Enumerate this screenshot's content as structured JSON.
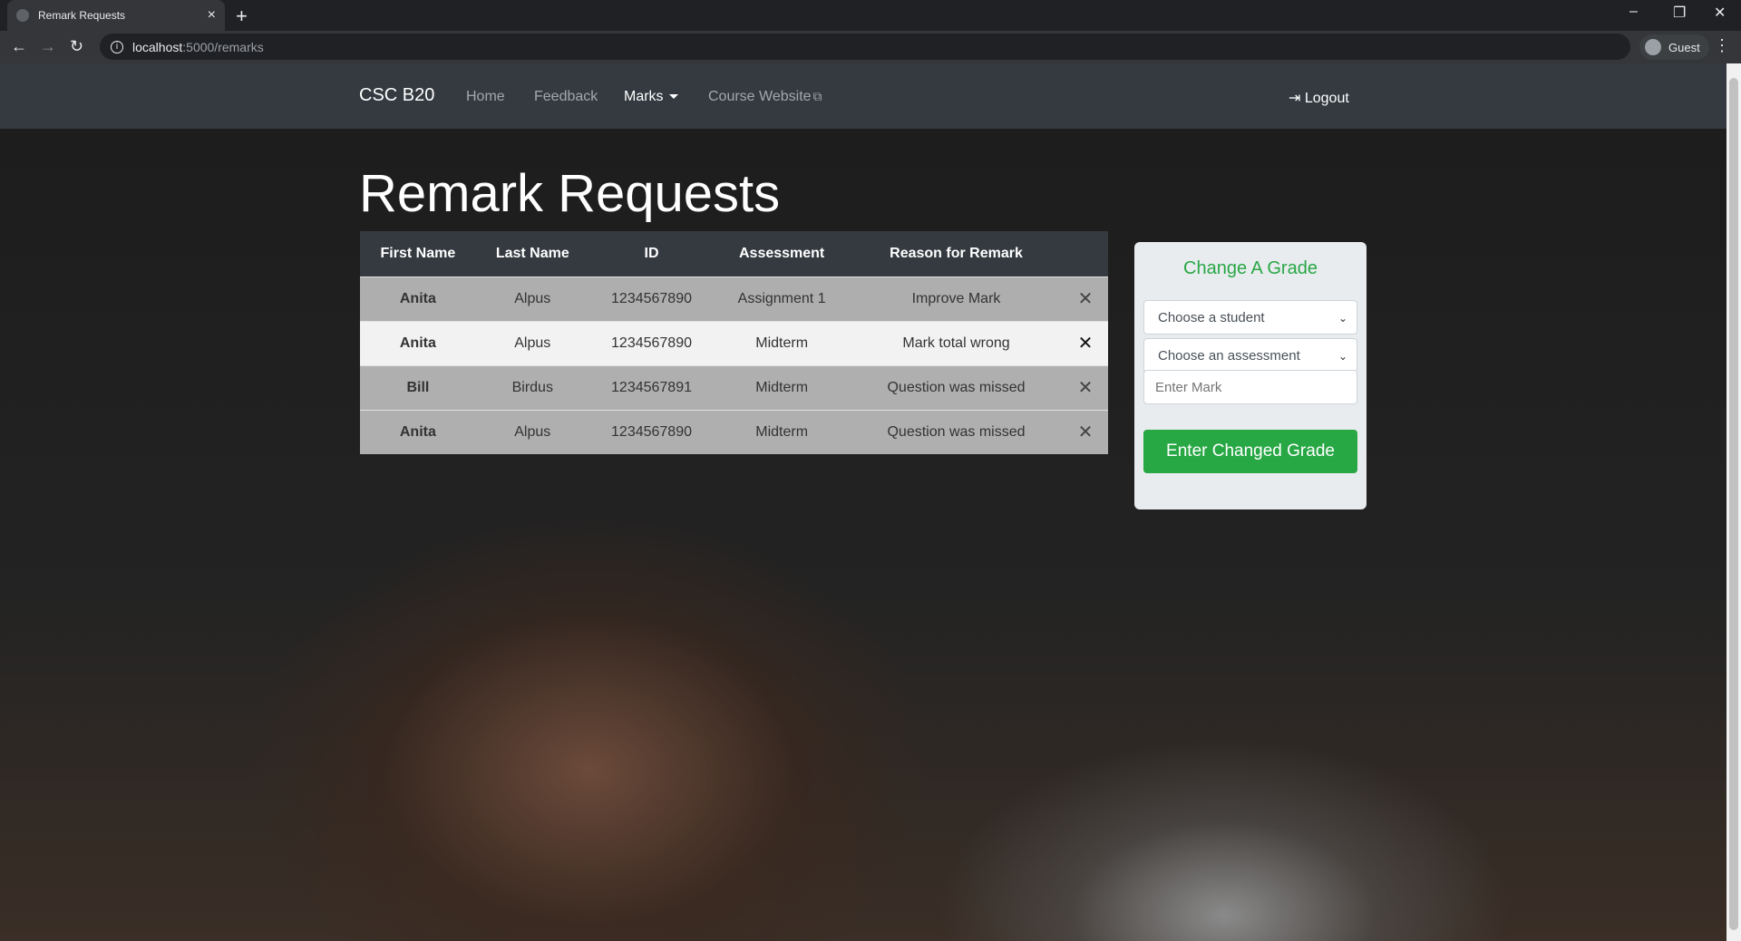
{
  "browser": {
    "tab_title": "Remark Requests",
    "url_host": "localhost",
    "url_path": ":5000/remarks",
    "profile": "Guest"
  },
  "navbar": {
    "brand": "CSC B20",
    "links": [
      "Home",
      "Feedback",
      "Marks",
      "Course Website"
    ],
    "logout": "Logout"
  },
  "page": {
    "title": "Remark Requests"
  },
  "table": {
    "headers": [
      "First Name",
      "Last Name",
      "ID",
      "Assessment",
      "Reason for Remark"
    ],
    "rows": [
      [
        "Anita",
        "Alpus",
        "1234567890",
        "Assignment 1",
        "Improve Mark"
      ],
      [
        "Anita",
        "Alpus",
        "1234567890",
        "Midterm",
        "Mark total wrong"
      ],
      [
        "Bill",
        "Birdus",
        "1234567891",
        "Midterm",
        "Question was missed"
      ],
      [
        "Anita",
        "Alpus",
        "1234567890",
        "Midterm",
        "Question was missed"
      ]
    ],
    "delete_glyph": "✕"
  },
  "grade_card": {
    "title": "Change A Grade",
    "student_select": "Choose a student",
    "assessment_select": "Choose an assessment",
    "mark_placeholder": "Enter Mark",
    "submit_label": "Enter Changed Grade"
  },
  "colors": {
    "navbar": "#343a40",
    "accent": "#28a745"
  }
}
